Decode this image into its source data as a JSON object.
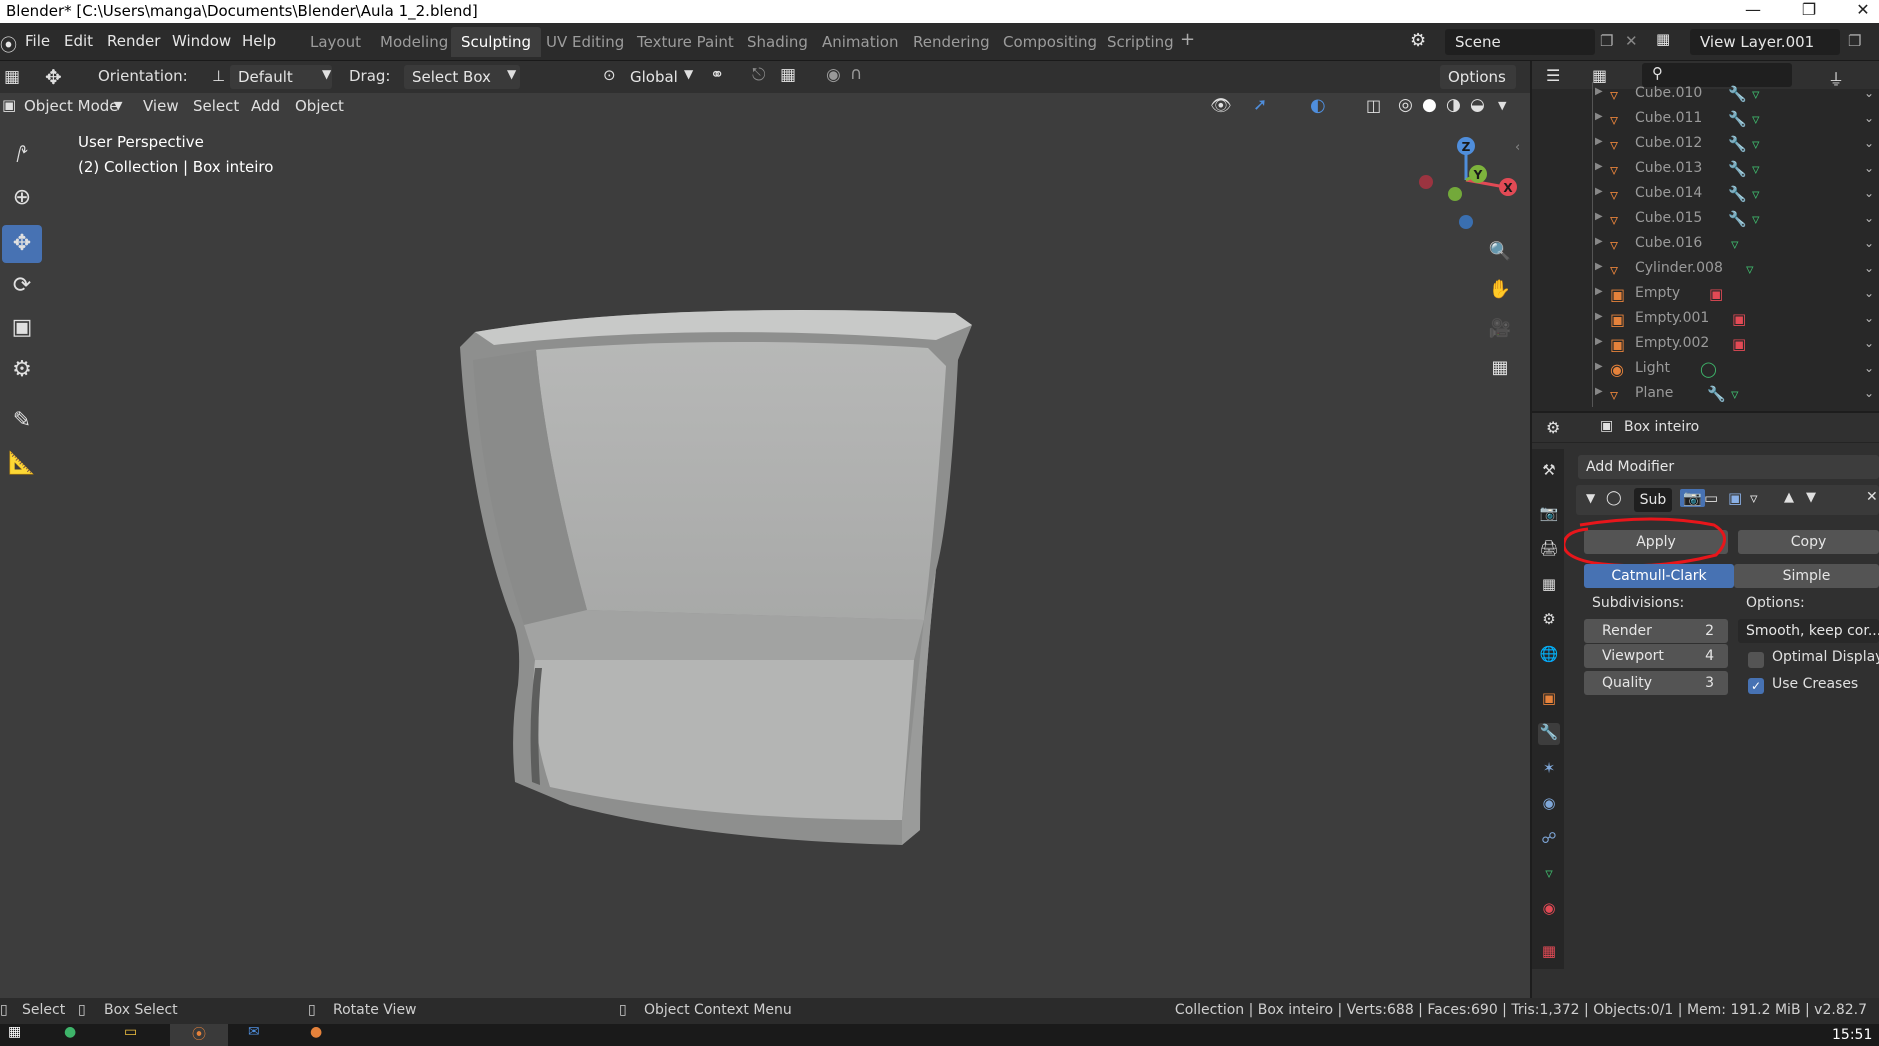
{
  "window": {
    "title": "Blender* [C:\\Users\\manga\\Documents\\Blender\\Aula 1_2.blend]"
  },
  "menu": [
    "File",
    "Edit",
    "Render",
    "Window",
    "Help"
  ],
  "workspaces": [
    "Layout",
    "Modeling",
    "Sculpting",
    "UV Editing",
    "Texture Paint",
    "Shading",
    "Animation",
    "Rendering",
    "Compositing",
    "Scripting"
  ],
  "active_workspace": "Sculpting",
  "scene": {
    "name": "Scene",
    "view_layer": "View Layer.001"
  },
  "tool_header": {
    "orientation_label": "Orientation:",
    "orientation_value": "Default",
    "drag_label": "Drag:",
    "drag_value": "Select Box",
    "transform_orientation": "Global",
    "options_label": "Options"
  },
  "viewport_header": {
    "mode": "Object Mode",
    "menus": [
      "View",
      "Select",
      "Add",
      "Object"
    ]
  },
  "viewport": {
    "perspective": "User Perspective",
    "collection_info": "(2) Collection | Box inteiro",
    "gizmo_axes": {
      "x": "X",
      "y": "Y",
      "z": "Z"
    }
  },
  "outliner": {
    "items": [
      {
        "name": "Cube.010",
        "type": "mesh"
      },
      {
        "name": "Cube.011",
        "type": "mesh"
      },
      {
        "name": "Cube.012",
        "type": "mesh"
      },
      {
        "name": "Cube.013",
        "type": "mesh"
      },
      {
        "name": "Cube.014",
        "type": "mesh"
      },
      {
        "name": "Cube.015",
        "type": "mesh"
      },
      {
        "name": "Cube.016",
        "type": "mesh"
      },
      {
        "name": "Cylinder.008",
        "type": "mesh"
      },
      {
        "name": "Empty",
        "type": "empty"
      },
      {
        "name": "Empty.001",
        "type": "empty"
      },
      {
        "name": "Empty.002",
        "type": "empty"
      },
      {
        "name": "Light",
        "type": "light"
      },
      {
        "name": "Plane",
        "type": "mesh"
      }
    ]
  },
  "properties": {
    "object_name": "Box inteiro",
    "add_modifier": "Add Modifier",
    "modifier": {
      "name": "Sub",
      "apply": "Apply",
      "copy": "Copy",
      "modes": [
        "Catmull-Clark",
        "Simple"
      ],
      "active_mode": "Catmull-Clark",
      "subdivisions_label": "Subdivisions:",
      "options_label": "Options:",
      "render_label": "Render",
      "render_value": "2",
      "viewport_label": "Viewport",
      "viewport_value": "4",
      "quality_label": "Quality",
      "quality_value": "3",
      "uv_smooth": "Smooth, keep cor...",
      "optimal_display": "Optimal Display",
      "optimal_display_checked": false,
      "use_creases": "Use Creases",
      "use_creases_checked": true
    },
    "annotation_color": "#e8161b"
  },
  "status_bar": {
    "select": "Select",
    "box_select": "Box Select",
    "rotate_view": "Rotate View",
    "context_menu": "Object Context Menu",
    "stats": "Collection | Box inteiro | Verts:688 | Faces:690 | Tris:1,372 | Objects:0/1 | Mem: 191.2 MiB | v2.82.7"
  },
  "taskbar": {
    "time": "15:51"
  },
  "colors": {
    "accent": "#4772b3",
    "active_tab": "#3d3d3d",
    "mesh_icon": "#e5823b"
  }
}
